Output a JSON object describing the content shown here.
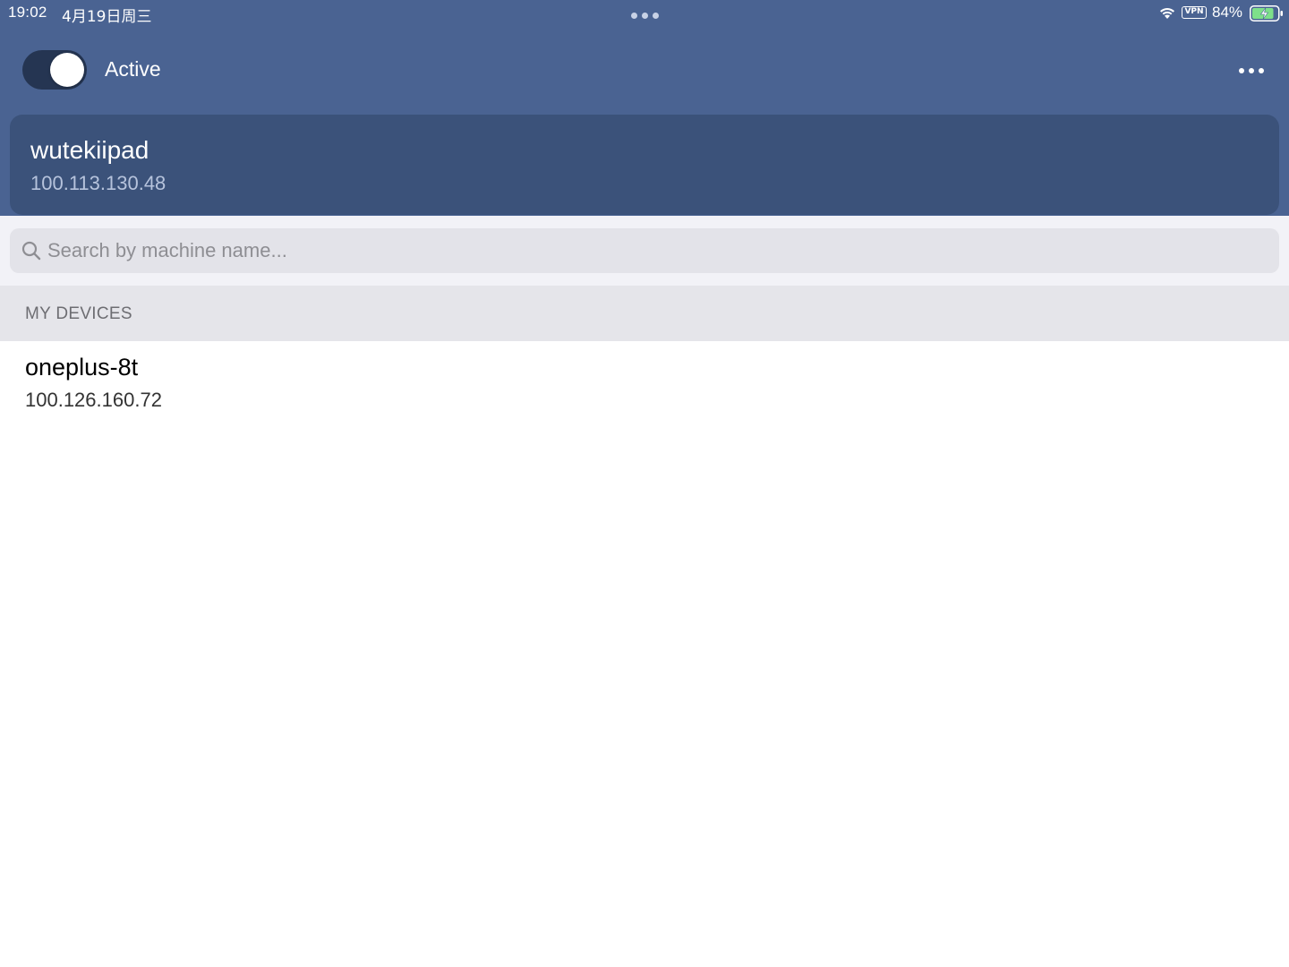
{
  "status_bar": {
    "time": "19:02",
    "date": "4月19日周三",
    "vpn_label": "VPN",
    "battery_percent": "84%",
    "battery_level": 0.84,
    "battery_charging": true,
    "icons": [
      "wifi-icon",
      "vpn-badge",
      "battery-charging-icon"
    ]
  },
  "header": {
    "toggle": {
      "label": "Active",
      "on": true
    },
    "more_icon": "ellipsis-icon",
    "colors": {
      "background": "#4a6392",
      "card": "#3b527a",
      "toggle_track": "#253552"
    }
  },
  "this_device": {
    "name": "wutekiipad",
    "ip": "100.113.130.48"
  },
  "search": {
    "value": "",
    "placeholder": "Search by machine name..."
  },
  "sections": [
    {
      "title": "MY DEVICES",
      "devices": [
        {
          "name": "oneplus-8t",
          "ip": "100.126.160.72"
        }
      ]
    }
  ]
}
